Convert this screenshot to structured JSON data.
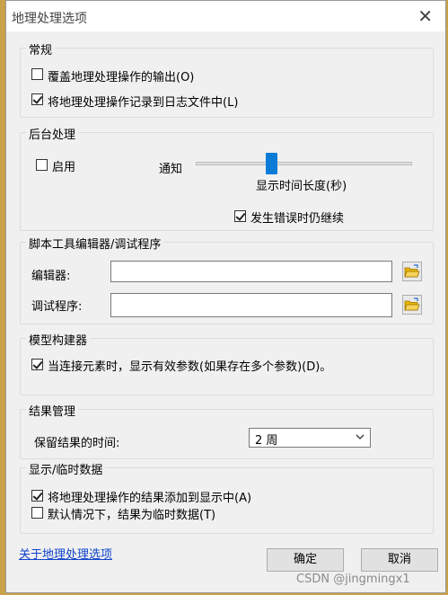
{
  "window": {
    "title": "地理处理选项"
  },
  "general": {
    "legend": "常规",
    "overwrite": {
      "label": "覆盖地理处理操作的输出(O)",
      "checked": false
    },
    "log": {
      "label": "将地理处理操作记录到日志文件中(L)",
      "checked": true
    }
  },
  "background": {
    "legend": "后台处理",
    "enable": {
      "label": "启用",
      "checked": false
    },
    "notify_label": "通知",
    "slider_label": "显示时间长度(秒)",
    "slider_level": 0.35,
    "continue": {
      "label": "发生错误时仍继续",
      "checked": true
    }
  },
  "script": {
    "legend": "脚本工具编辑器/调试程序",
    "editor_label": "编辑器:",
    "debugger_label": "调试程序:",
    "editor_value": "",
    "debugger_value": ""
  },
  "model": {
    "legend": "模型构建器",
    "valid_params": {
      "label": "当连接元素时，显示有效参数(如果存在多个参数)(D)。",
      "checked": true
    }
  },
  "results": {
    "legend": "结果管理",
    "keep_label": "保留结果的时间:",
    "keep_value": "2 周"
  },
  "display": {
    "legend": "显示/临时数据",
    "add_results": {
      "label": "将地理处理操作的结果添加到显示中(A)",
      "checked": true
    },
    "temp_default": {
      "label": "默认情况下，结果为临时数据(T)",
      "checked": false
    }
  },
  "footer": {
    "about_link": "关于地理处理选项",
    "ok": "确定",
    "cancel": "取消",
    "watermark": "CSDN @jingmingx1"
  },
  "icons": {
    "close": "close-icon",
    "folder": "folder-open-icon",
    "dropdown": "chevron-down-icon"
  }
}
